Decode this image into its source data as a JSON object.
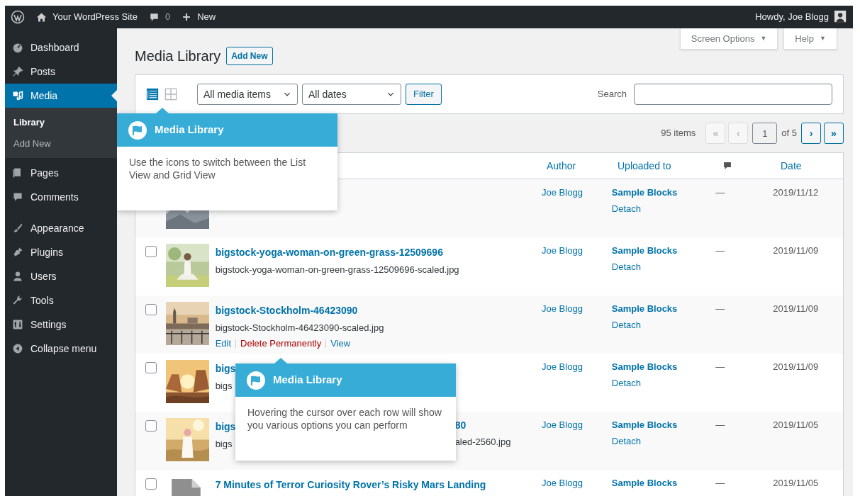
{
  "admin_bar": {
    "site_name": "Your WordPress Site",
    "comments_count": "0",
    "new_label": "New",
    "greeting": "Howdy, Joe Blogg"
  },
  "sidebar": {
    "items": [
      {
        "label": "Dashboard",
        "selected": false
      },
      {
        "label": "Posts",
        "selected": false
      },
      {
        "label": "Media",
        "selected": true,
        "children": [
          {
            "label": "Library",
            "selected": true
          },
          {
            "label": "Add New",
            "selected": false
          }
        ]
      },
      {
        "label": "Pages",
        "selected": false
      },
      {
        "label": "Comments",
        "selected": false
      },
      {
        "label": "Appearance",
        "selected": false
      },
      {
        "label": "Plugins",
        "selected": false
      },
      {
        "label": "Users",
        "selected": false
      },
      {
        "label": "Tools",
        "selected": false
      },
      {
        "label": "Settings",
        "selected": false
      }
    ],
    "collapse_label": "Collapse menu"
  },
  "screen_meta": [
    {
      "label": "Screen Options",
      "caret": "▼"
    },
    {
      "label": "Help",
      "caret": "▼"
    }
  ],
  "page": {
    "title": "Media Library",
    "add_new": "Add New"
  },
  "toolbar": {
    "views": [
      {
        "kind": "list",
        "selected": true
      },
      {
        "kind": "grid",
        "selected": false
      }
    ],
    "filters": [
      "All media items",
      "All dates"
    ],
    "filter_button": "Filter",
    "search_label": "Search"
  },
  "pagination": {
    "count": "95 items",
    "buttons": [
      {
        "label": "«",
        "disabled": true
      },
      {
        "label": "‹",
        "disabled": true
      }
    ],
    "page": "1",
    "of": "of 5",
    "next_buttons": [
      {
        "label": "›",
        "disabled": false
      },
      {
        "label": "»",
        "disabled": false
      }
    ]
  },
  "table": {
    "columns": [
      {
        "kind": "text",
        "label": "Author"
      },
      {
        "kind": "text",
        "label": "Uploaded to"
      },
      {
        "kind": "comments"
      },
      {
        "kind": "text",
        "label": "Date"
      }
    ],
    "rows": [
      {
        "thumbnail": {
          "kind": "picture"
        },
        "author": "Joe Blogg",
        "uploaded_to": "Sample Blocks",
        "detach": "Detach",
        "comments": "—",
        "date": "2019/11/12"
      },
      {
        "checked": false,
        "thumbnail": {
          "kind": "picture"
        },
        "title_parts": [
          "bigstock-yoga-woman-on-green-grass-12509696"
        ],
        "filename_parts": [
          "bigstock-yoga-woman-on-green-grass-12509696-scaled.jpg"
        ],
        "author": "Joe Blogg",
        "uploaded_to": "Sample Blocks",
        "detach": "Detach",
        "comments": "—",
        "date": "2019/11/09"
      },
      {
        "checked": false,
        "thumbnail": {
          "kind": "picture"
        },
        "title_parts": [
          "bigstock-Stockholm-46423090"
        ],
        "filename_parts": [
          "bigstock-Stockholm-46423090-scaled.jpg"
        ],
        "actions": [
          {
            "label": "Edit",
            "kind": "link"
          },
          {
            "label": "Delete Permanently",
            "kind": "delete"
          },
          {
            "label": "View",
            "kind": "link"
          }
        ],
        "author": "Joe Blogg",
        "uploaded_to": "Sample Blocks",
        "detach": "Detach",
        "comments": "—",
        "date": "2019/11/09"
      },
      {
        "checked": false,
        "thumbnail": {
          "kind": "picture"
        },
        "title_parts": [
          "bigs"
        ],
        "filename_parts": [
          "bigs"
        ],
        "author": "Joe Blogg",
        "uploaded_to": "Sample Blocks",
        "detach": "Detach",
        "comments": "—",
        "date": "2019/11/09"
      },
      {
        "checked": false,
        "thumbnail": {
          "kind": "picture"
        },
        "title_parts": [
          "bigs",
          "80"
        ],
        "filename_parts": [
          "bigs",
          "aled-2560.jpg"
        ],
        "author": "Joe Blogg",
        "uploaded_to": "Sample Blocks",
        "detach": "Detach",
        "comments": "—",
        "date": "2019/11/05"
      },
      {
        "checked": false,
        "thumbnail": {
          "kind": "file"
        },
        "title_parts": [
          "7 Minutes of Terror Curiosity Rover’s Risky Mars Landing"
        ],
        "author": "Joe Blogg",
        "uploaded_to": "Sample Blocks",
        "comments": "—",
        "date": "2019/11/05"
      }
    ]
  },
  "tooltips": [
    {
      "title": "Media Library",
      "text": "Use the icons to switch between the List View and Grid View"
    },
    {
      "title": "Media Library",
      "text": "Hovering the cursor over each row will show you various options you can perform"
    }
  ]
}
